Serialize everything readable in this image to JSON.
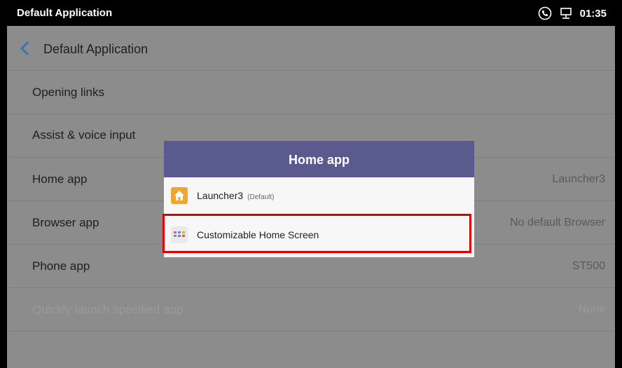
{
  "status_bar": {
    "title": "Default Application",
    "time": "01:35",
    "icons": [
      "phone-call-icon",
      "network-icon"
    ]
  },
  "header": {
    "back_icon": "chevron-left-icon",
    "title": "Default Application"
  },
  "settings": [
    {
      "label": "Opening links",
      "value": ""
    },
    {
      "label": "Assist & voice input",
      "value": ""
    },
    {
      "label": "Home app",
      "value": "Launcher3"
    },
    {
      "label": "Browser app",
      "value": "No default Browser"
    },
    {
      "label": "Phone app",
      "value": "ST500"
    },
    {
      "label": "Quickly launch specified app",
      "value": "None",
      "disabled": true
    }
  ],
  "dialog": {
    "title": "Home app",
    "options": [
      {
        "label": "Launcher3",
        "tag": "(Default)",
        "icon": "home-launcher-icon"
      },
      {
        "label": "Customizable Home Screen",
        "tag": "",
        "icon": "grid-app-icon",
        "highlighted": true
      }
    ]
  },
  "colors": {
    "dialog_header": "#5a5a8e",
    "overlay_background": "#8c8c8c",
    "highlight_border": "#e00000",
    "back_chevron": "#3b6fb6"
  }
}
